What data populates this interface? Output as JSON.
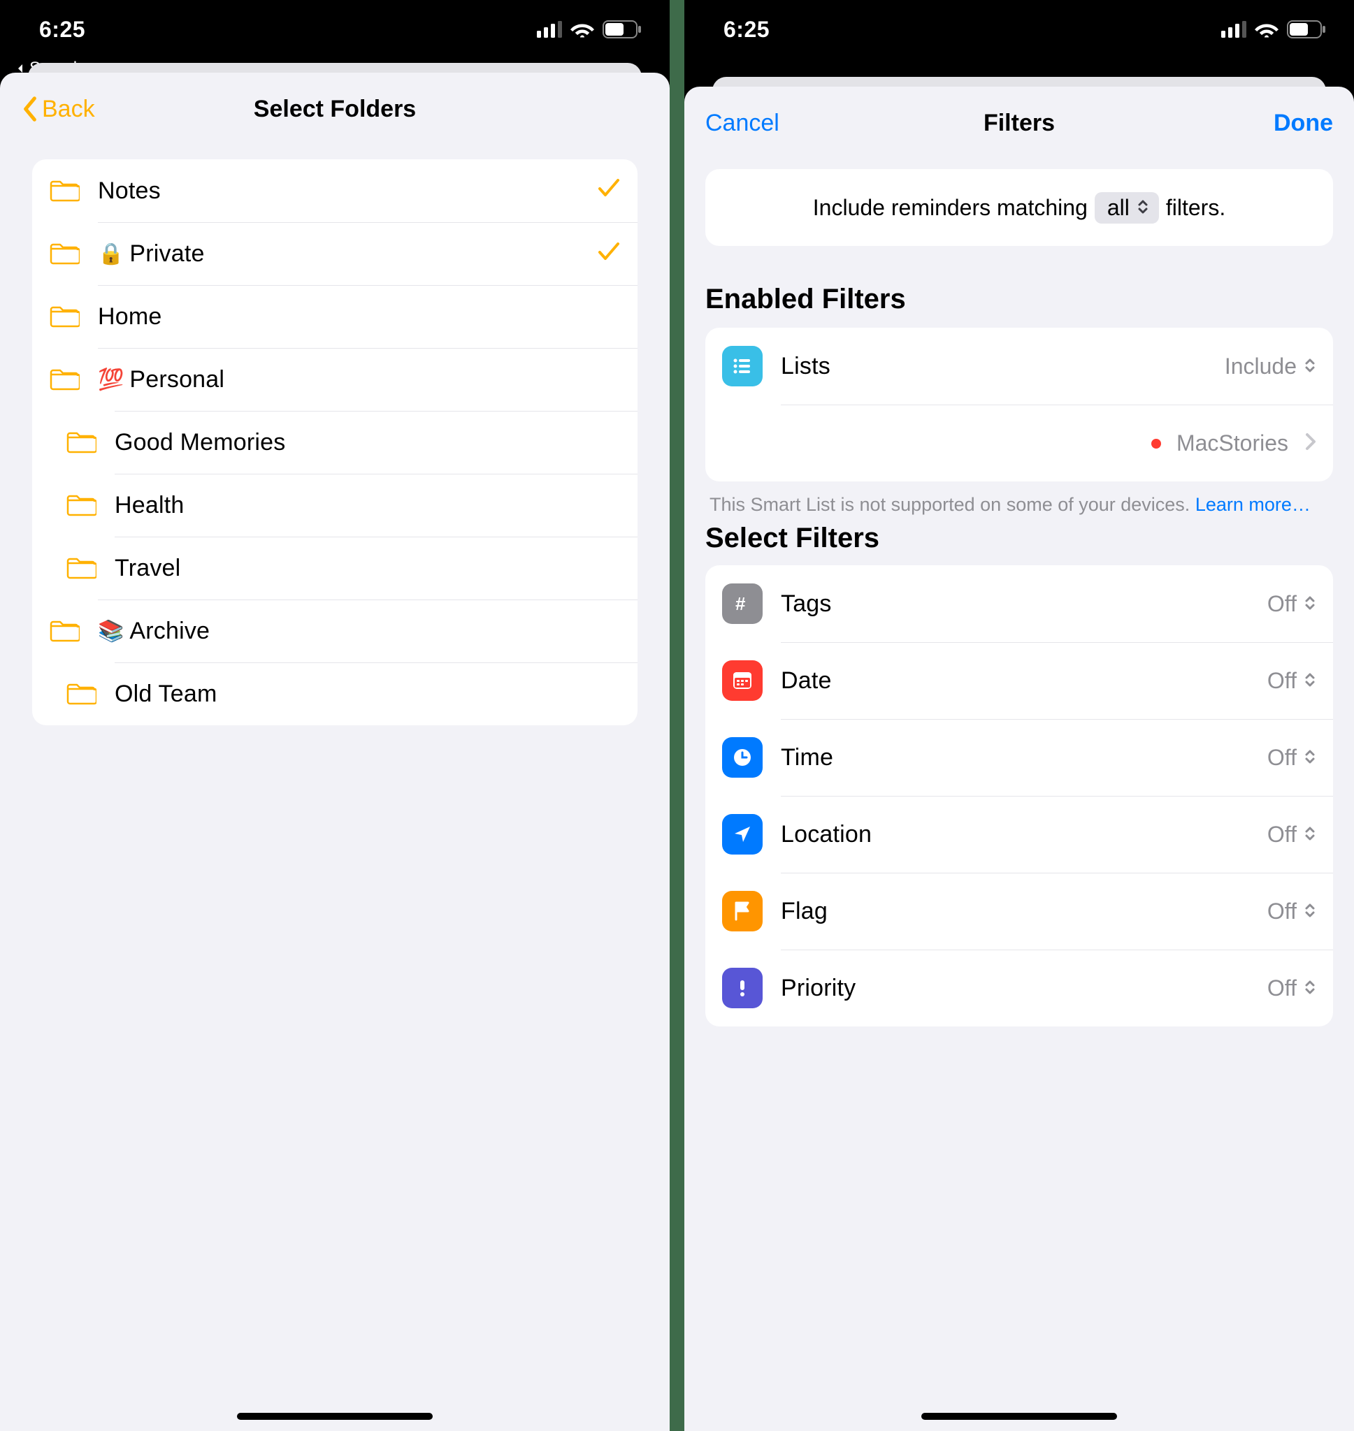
{
  "status": {
    "time": "6:25"
  },
  "breadcrumb": {
    "label": "Search"
  },
  "left": {
    "back": "Back",
    "title": "Select Folders",
    "folders": [
      {
        "label": "Notes",
        "indent": 0,
        "emoji": "",
        "checked": true
      },
      {
        "label": "Private",
        "indent": 1,
        "emoji": "🔒",
        "checked": true
      },
      {
        "label": "Home",
        "indent": 1,
        "emoji": "",
        "checked": false
      },
      {
        "label": "Personal",
        "indent": 1,
        "emoji": "💯",
        "checked": false
      },
      {
        "label": "Good Memories",
        "indent": 2,
        "emoji": "",
        "checked": false
      },
      {
        "label": "Health",
        "indent": 2,
        "emoji": "",
        "checked": false
      },
      {
        "label": "Travel",
        "indent": 2,
        "emoji": "",
        "checked": false
      },
      {
        "label": "Archive",
        "indent": 1,
        "emoji": "📚",
        "checked": false
      },
      {
        "label": "Old Team",
        "indent": 2,
        "emoji": "",
        "checked": false
      }
    ]
  },
  "right": {
    "cancel": "Cancel",
    "done": "Done",
    "title": "Filters",
    "header": {
      "pre": "Include reminders matching",
      "mode": "all",
      "post": "filters."
    },
    "section_enabled": "Enabled Filters",
    "enabled": {
      "lists_label": "Lists",
      "lists_value": "Include",
      "sub_label": "MacStories"
    },
    "footnote_text": "This Smart List is not supported on some of your devices. ",
    "footnote_link": "Learn more…",
    "section_select": "Select Filters",
    "filters": [
      {
        "key": "tags",
        "label": "Tags",
        "value": "Off",
        "color": "gray"
      },
      {
        "key": "date",
        "label": "Date",
        "value": "Off",
        "color": "red"
      },
      {
        "key": "time",
        "label": "Time",
        "value": "Off",
        "color": "blue"
      },
      {
        "key": "location",
        "label": "Location",
        "value": "Off",
        "color": "blue"
      },
      {
        "key": "flag",
        "label": "Flag",
        "value": "Off",
        "color": "orange"
      },
      {
        "key": "priority",
        "label": "Priority",
        "value": "Off",
        "color": "purple"
      }
    ]
  }
}
